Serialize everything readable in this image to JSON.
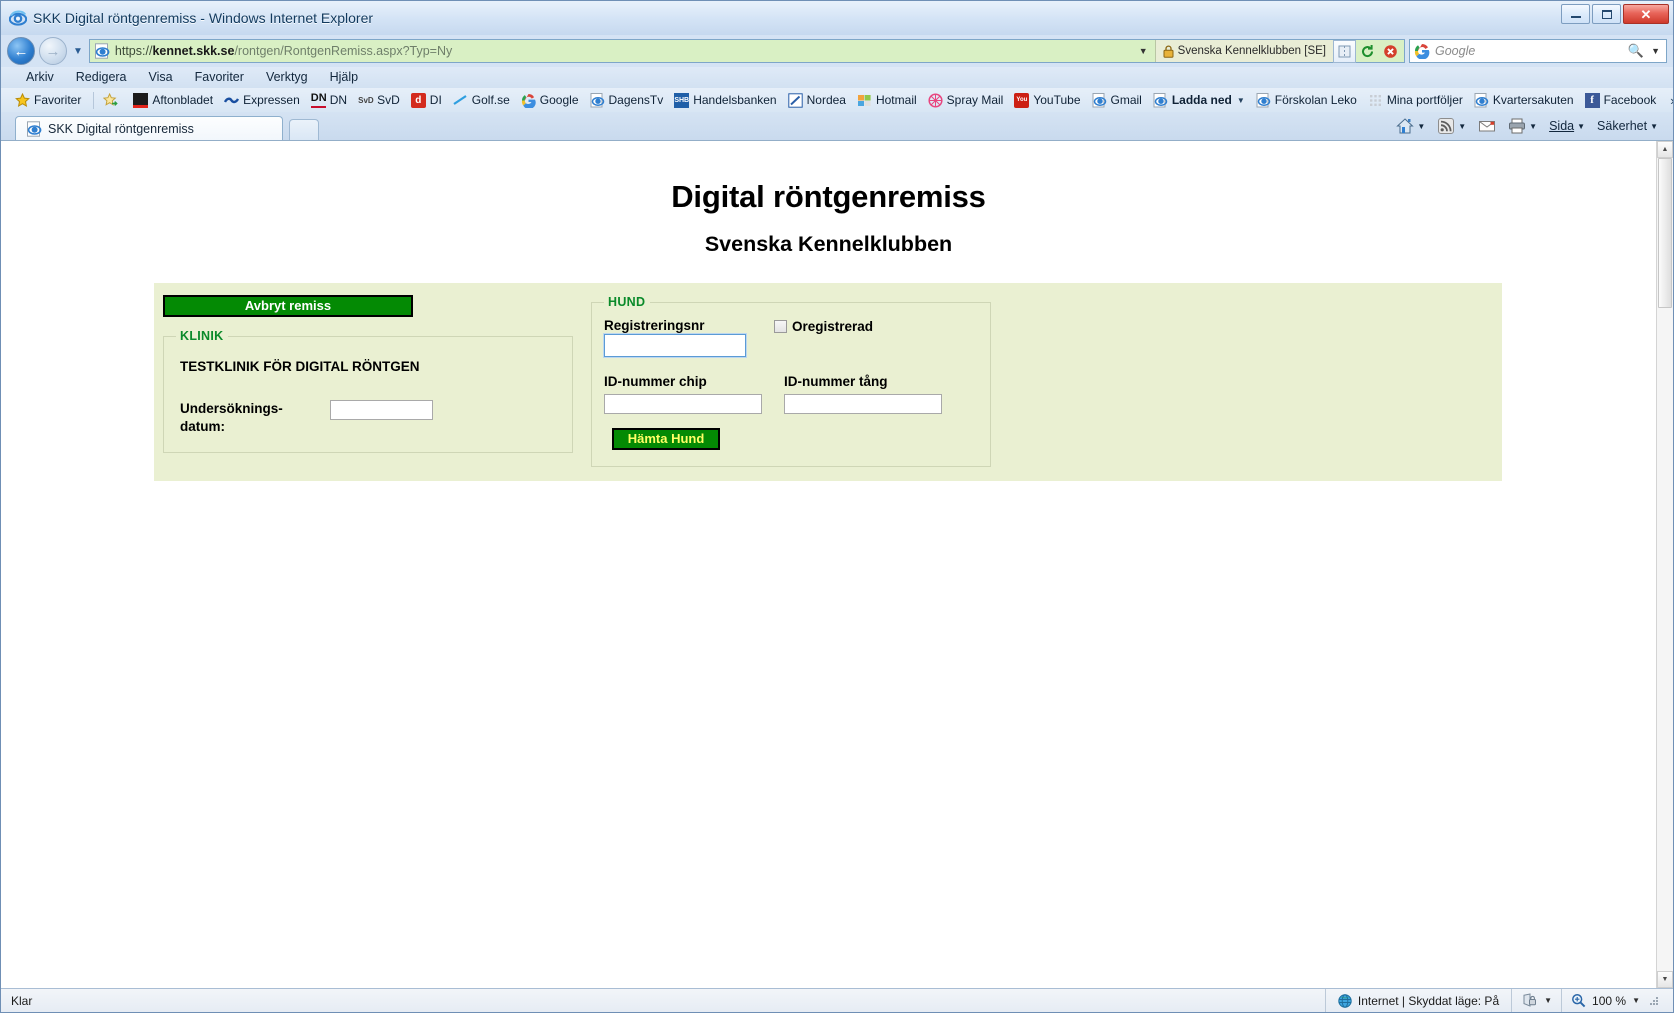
{
  "window": {
    "title": "SKK Digital röntgenremiss - Windows Internet Explorer",
    "minimize_label": "Minimera",
    "maximize_label": "Maximera",
    "close_label": "Stäng"
  },
  "nav": {
    "back_label": "Tillbaka",
    "forward_label": "Framåt",
    "recent_label": "Senaste sidor",
    "url_protocol": "https://",
    "url_host": "kennet.skk.se",
    "url_path": "/rontgen/RontgenRemiss.aspx?Typ=Ny",
    "url_full": "https://kennet.skk.se/rontgen/RontgenRemiss.aspx?Typ=Ny",
    "security_chip": "Svenska Kennelklubben [SE]",
    "compat_label": "Kompatibilitetsvy",
    "refresh_label": "Uppdatera",
    "stop_label": "Stoppa",
    "search_engine": "Google",
    "search_placeholder": "Google",
    "search_value": ""
  },
  "menubar": {
    "items": [
      {
        "label": "Arkiv",
        "accel": "A"
      },
      {
        "label": "Redigera",
        "accel": "R"
      },
      {
        "label": "Visa",
        "accel": "s"
      },
      {
        "label": "Favoriter",
        "accel": "F"
      },
      {
        "label": "Verktyg",
        "accel": "y"
      },
      {
        "label": "Hjälp",
        "accel": "H"
      }
    ]
  },
  "favorites_bar": {
    "button_label": "Favoriter",
    "add_label": "Lägg till i Favoritfältet",
    "overflow_label": "»",
    "items": [
      {
        "label": "Aftonbladet",
        "icon": "aftonbladet-icon"
      },
      {
        "label": "Expressen",
        "icon": "expressen-icon"
      },
      {
        "label": "DN",
        "icon": "dn-icon"
      },
      {
        "label": "SvD",
        "icon": "svd-icon"
      },
      {
        "label": "DI",
        "icon": "di-icon"
      },
      {
        "label": "Golf.se",
        "icon": "golf-icon"
      },
      {
        "label": "Google",
        "icon": "google-icon"
      },
      {
        "label": "DagensTv",
        "icon": "ie-icon"
      },
      {
        "label": "Handelsbanken",
        "icon": "shb-icon"
      },
      {
        "label": "Nordea",
        "icon": "nordea-icon"
      },
      {
        "label": "Hotmail",
        "icon": "hotmail-icon"
      },
      {
        "label": "Spray Mail",
        "icon": "spray-icon"
      },
      {
        "label": "YouTube",
        "icon": "youtube-icon"
      },
      {
        "label": "Gmail",
        "icon": "ie-icon"
      },
      {
        "label": "Ladda ned",
        "icon": "ie-icon",
        "bold": true,
        "has_caret": true
      },
      {
        "label": "Förskolan Leko",
        "icon": "ie-icon"
      },
      {
        "label": "Mina portföljer",
        "icon": "grid-icon"
      },
      {
        "label": "Kvartersakuten",
        "icon": "ie-icon"
      },
      {
        "label": "Facebook",
        "icon": "facebook-icon"
      }
    ]
  },
  "tabs": {
    "items": [
      {
        "label": "SKK Digital röntgenremiss",
        "active": true
      }
    ],
    "new_tab_label": "Ny flik"
  },
  "command_bar": {
    "home_label": "Startsida",
    "feeds_label": "Webbflöden",
    "mail_label": "Läs e-post",
    "print_label": "Skriv ut",
    "page_label": "Sida",
    "safety_label": "Säkerhet"
  },
  "page": {
    "title": "Digital röntgenremiss",
    "subtitle": "Svenska Kennelklubben",
    "cancel_button": "Avbryt remiss",
    "clinic": {
      "legend": "KLINIK",
      "name": "TESTKLINIK FÖR DIGITAL RÖNTGEN",
      "exam_date_label": "Undersöknings-\ndatum:",
      "exam_date_label_line1": "Undersöknings-",
      "exam_date_label_line2": "datum:",
      "exam_date_value": ""
    },
    "dog": {
      "legend": "HUND",
      "reg_label": "Registreringsnr",
      "reg_value": "",
      "unregistered_label": "Oregistrerad",
      "unregistered_checked": false,
      "chip_label": "ID-nummer chip",
      "chip_value": "",
      "tong_label": "ID-nummer tång",
      "tong_value": "",
      "fetch_button": "Hämta Hund"
    },
    "colors": {
      "panel_bg": "#eaf0d2",
      "green_button": "#048a04",
      "legend_green": "#0a8a2a",
      "fetch_text": "#ffff66"
    }
  },
  "statusbar": {
    "status_text": "Klar",
    "zone_text": "Internet | Skyddat läge: På",
    "zoom_text": "100 %"
  }
}
